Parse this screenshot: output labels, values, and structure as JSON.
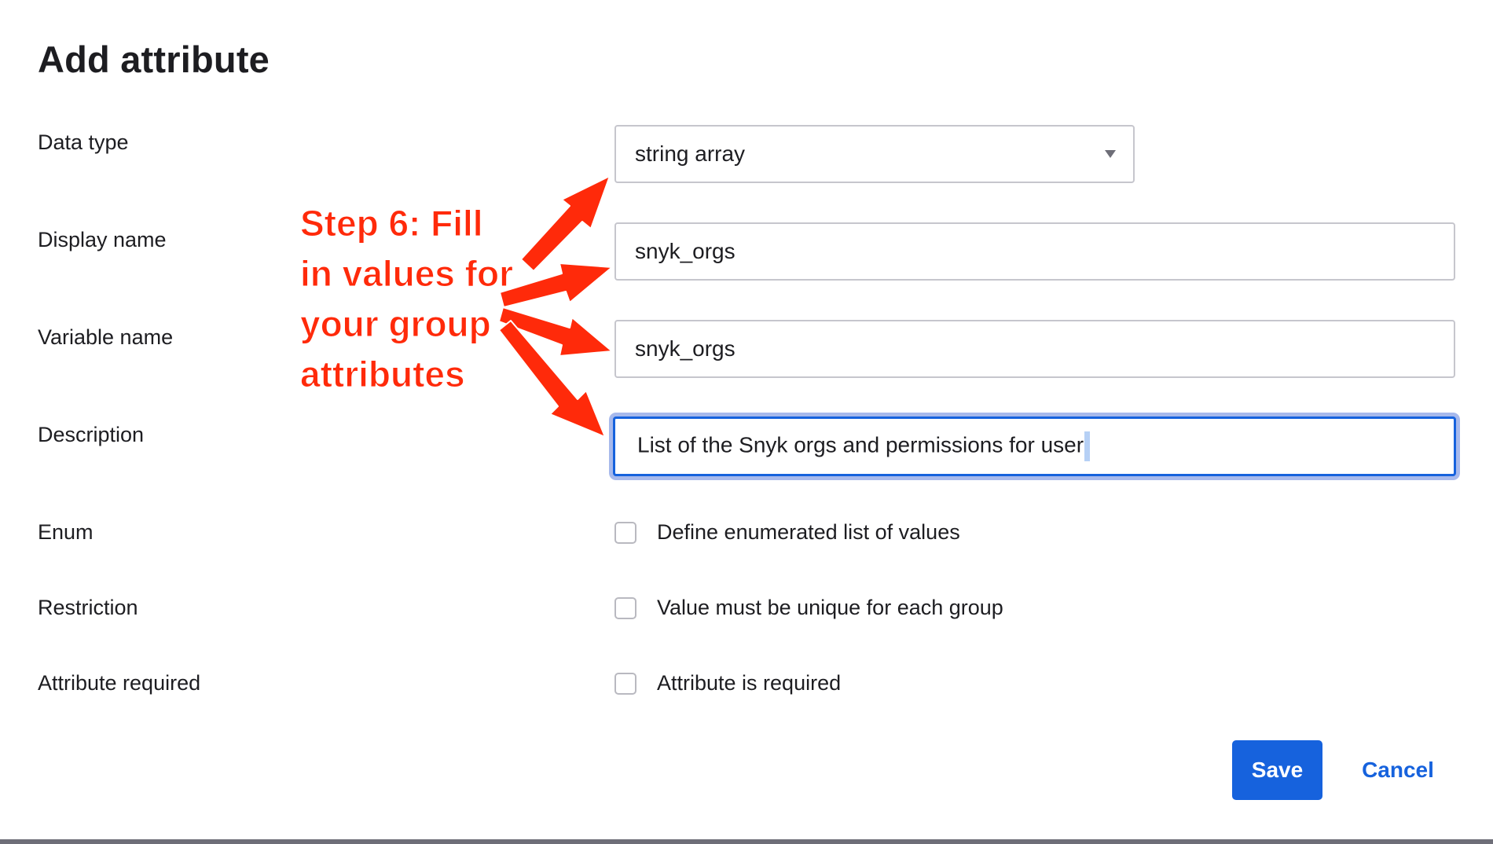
{
  "dialog": {
    "title": "Add attribute"
  },
  "fields": {
    "data_type": {
      "label": "Data type",
      "value": "string array"
    },
    "display_name": {
      "label": "Display name",
      "value": "snyk_orgs"
    },
    "variable_name": {
      "label": "Variable name",
      "value": "snyk_orgs"
    },
    "description": {
      "label": "Description",
      "value": "List of the Snyk orgs and permissions for user"
    },
    "enum": {
      "label": "Enum",
      "checkbox_label": "Define enumerated list of values",
      "checked": false
    },
    "restriction": {
      "label": "Restriction",
      "checkbox_label": "Value must be unique for each group",
      "checked": false
    },
    "attribute_required": {
      "label": "Attribute required",
      "checkbox_label": "Attribute is required",
      "checked": false
    }
  },
  "buttons": {
    "save": "Save",
    "cancel": "Cancel"
  },
  "annotation": {
    "lines": [
      "Step 6: Fill",
      "in values for",
      "your group",
      "attributes"
    ],
    "color": "#ff2a0a"
  },
  "colors": {
    "accent": "#1662dd",
    "focus_ring": "#a7b9ec",
    "border": "#c6c6cd",
    "text": "#1d1d21"
  },
  "icons": {
    "select_caret": "chevron-down-icon"
  }
}
